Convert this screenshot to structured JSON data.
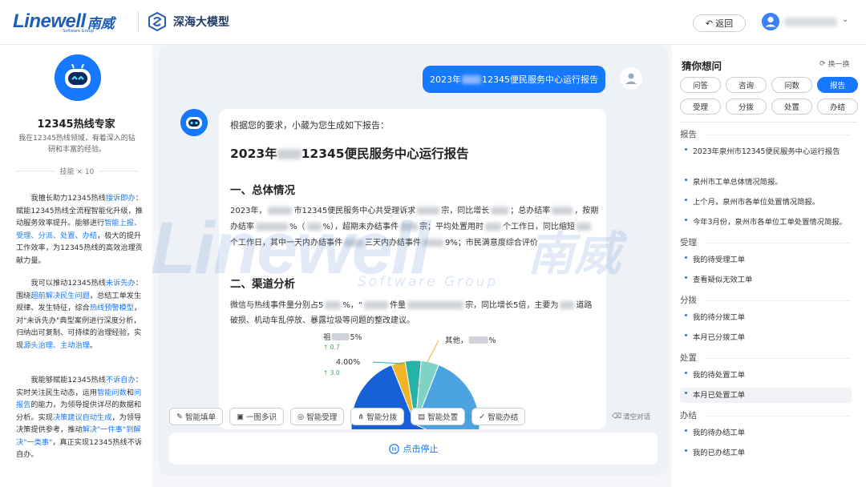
{
  "header": {
    "logo_en": "Linewell",
    "logo_cn": "南威",
    "logo_sub": "Software Group",
    "product_title": "深海大模型",
    "back_label": "返回",
    "back_icon": "undo-icon",
    "user_avatar_icon": "user-avatar-icon"
  },
  "assistant": {
    "name": "12345热线专家",
    "description": "我在12345热线领域，有着深入的钻研和丰富的经验。",
    "skills_label": "技能 × 10",
    "paragraphs": [
      [
        {
          "t": "我擅长助力12345热线"
        },
        {
          "t": "接诉即办",
          "hl": true
        },
        {
          "t": "：赋能12345热线全流程智能化升级，推动服务效率提升。能够进行"
        },
        {
          "t": "智能上报、受理、分派、处置、办结",
          "hl": true
        },
        {
          "t": "，极大的提升工作效率，为12345热线的高效治理贡献力量。"
        }
      ],
      [
        {
          "t": "我可以推动12345热线"
        },
        {
          "t": "未诉先办",
          "hl": true
        },
        {
          "t": "：围绕"
        },
        {
          "t": "超前解决民生问题",
          "hl": true
        },
        {
          "t": "，总结工单发生规律、发生特征，综合"
        },
        {
          "t": "热线预警模型",
          "hl": true
        },
        {
          "t": "，对\"未诉先办\"典型案例进行深度分析，归纳出可复制、可持续的治理经验，实现"
        },
        {
          "t": "源头治理、主动治理",
          "hl": true
        },
        {
          "t": "。"
        }
      ],
      [
        {
          "t": "我能够赋能12345热线"
        },
        {
          "t": "不诉自办",
          "hl": true
        },
        {
          "t": "：实时关注民生动态，运用"
        },
        {
          "t": "智能问数",
          "hl": true
        },
        {
          "t": "和"
        },
        {
          "t": "问报告",
          "hl": true
        },
        {
          "t": "的能力，为领导提供详尽的数据和分析。实现"
        },
        {
          "t": "决策建议自动生成",
          "hl": true
        },
        {
          "t": "，为领导决策提供参考，推动"
        },
        {
          "t": "解决\"一件事\"到解决\"一类事\"",
          "hl": true
        },
        {
          "t": "，真正实现12345热线不诉自办。"
        }
      ]
    ]
  },
  "chat": {
    "user_message_prefix": "2023年",
    "user_message_suffix": "12345便民服务中心运行报告",
    "report": {
      "intro": "根据您的要求，小葳为您生成如下报告：",
      "title_prefix": "2023年",
      "title_suffix": "12345便民服务中心运行报告",
      "section1_heading": "一、总体情况",
      "section1_parts": [
        "2023年，",
        "市12345便民服务中心共受理诉求",
        "宗，同比增长",
        "；总办结率",
        "，按期办结率",
        "%（",
        "%），超期未办结事件",
        "宗；平均处置用时",
        "个工作日，同比缩短",
        "个工作日，其中一天内办结事件",
        "三天内办结事件",
        "9%；市民满意度综合评价"
      ],
      "section2_heading": "二、渠道分析",
      "section2_parts": [
        "微信与热线事件量分别占5",
        "%，“",
        "件量",
        "宗，同比增长5倍，主要为",
        "道路破损、机动车乱停放、暴露垃圾等问题的整改建议。"
      ]
    },
    "stop_label": "点击停止",
    "clear_label": "清空对话"
  },
  "chart_data": {
    "type": "pie",
    "slices": [
      {
        "label": "其他",
        "value": 3.5,
        "color": "#f0b429"
      },
      {
        "label": "",
        "value": 4.0,
        "color": "#26b2a6"
      },
      {
        "label": "祖",
        "value": 4.5,
        "color": "#7fd3c6"
      },
      {
        "label": "",
        "value": 26.0,
        "color": "#4aa3df"
      },
      {
        "label": "",
        "value": 62.0,
        "color": "#1660d8"
      }
    ],
    "visible_labels": [
      {
        "text": "其他，",
        "suffix": "%"
      },
      {
        "text": "4.00%"
      },
      {
        "text": "祖",
        "suffix": "5%"
      },
      {
        "text": "↑ 0.7"
      },
      {
        "text": "↑ 3.0"
      }
    ]
  },
  "chips": [
    {
      "label": "智能填单",
      "icon": "edit-icon"
    },
    {
      "label": "一图多识",
      "icon": "image-icon"
    },
    {
      "label": "智能受理",
      "icon": "layers-icon"
    },
    {
      "label": "智能分拨",
      "icon": "sitemap-icon"
    },
    {
      "label": "智能处置",
      "icon": "document-icon"
    },
    {
      "label": "智能办结",
      "icon": "check-stamp-icon"
    }
  ],
  "suggestions": {
    "title": "猜你想问",
    "refresh_label": "换一换",
    "tags": [
      {
        "label": "问答",
        "active": false
      },
      {
        "label": "咨询",
        "active": false
      },
      {
        "label": "问数",
        "active": false
      },
      {
        "label": "报告",
        "active": true
      },
      {
        "label": "受理",
        "active": false
      },
      {
        "label": "分拨",
        "active": false
      },
      {
        "label": "处置",
        "active": false
      },
      {
        "label": "办结",
        "active": false
      }
    ],
    "groups": [
      {
        "title": "报告",
        "items": [
          "2023年泉州市12345便民服务中心运行报告",
          "泉州市工单总体情况简报。",
          "上个月，泉州市各单位处置情况简报。",
          "今年3月份，泉州市各单位工单处置情况简报。"
        ]
      },
      {
        "title": "受理",
        "items": [
          "我的待受理工单",
          "查看疑似无效工单"
        ]
      },
      {
        "title": "分拨",
        "items": [
          "我的待分拨工单",
          "本月已分拨工单"
        ]
      },
      {
        "title": "处置",
        "items": [
          "我的待处置工单",
          "本月已处置工单"
        ]
      },
      {
        "title": "办结",
        "items": [
          "我的待办结工单",
          "我的已办结工单"
        ]
      }
    ]
  },
  "watermark": {
    "en": "Linewell",
    "cn": "南威",
    "sub": "Software Group"
  },
  "colors": {
    "accent": "#1677ff",
    "brand": "#1d5fb8"
  }
}
